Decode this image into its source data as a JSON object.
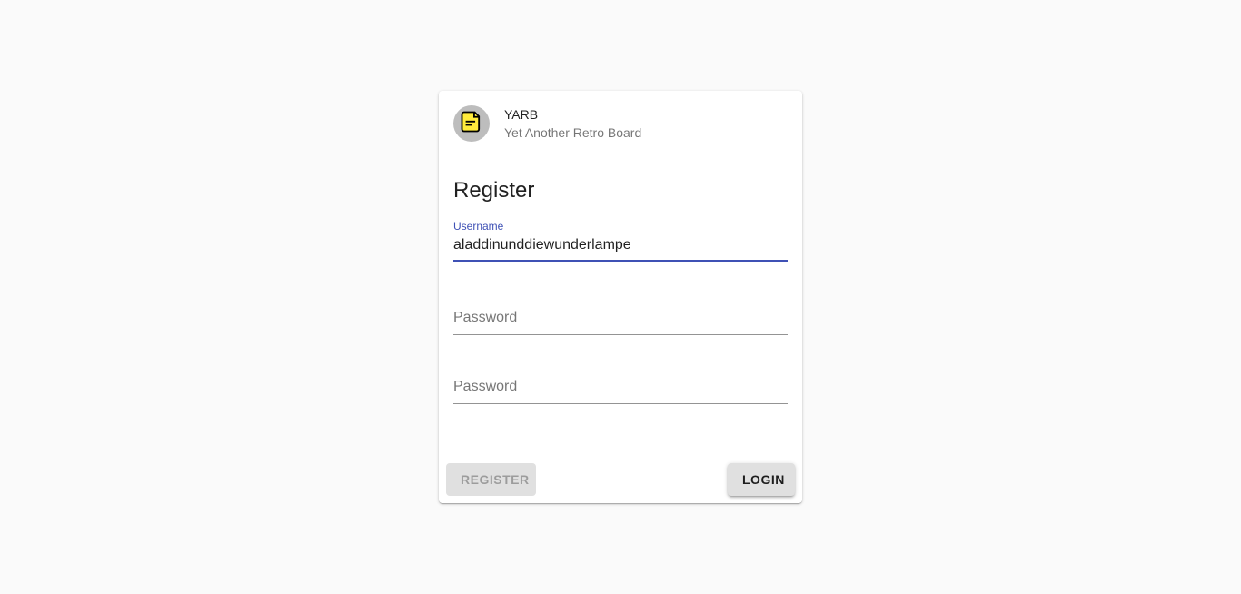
{
  "header": {
    "title": "YARB",
    "subtitle": "Yet Another Retro Board",
    "avatar_icon": "note-icon",
    "avatar_icon_color": "#ffeb3b"
  },
  "form": {
    "title": "Register",
    "username": {
      "label": "Username",
      "value": "aladdinunddiewunderlampe"
    },
    "password": {
      "placeholder": "Password"
    },
    "password_confirm": {
      "placeholder": "Password"
    }
  },
  "actions": {
    "register_label": "Register",
    "login_label": "Login"
  },
  "colors": {
    "accent": "#3f51b5",
    "background": "#fafafa"
  }
}
